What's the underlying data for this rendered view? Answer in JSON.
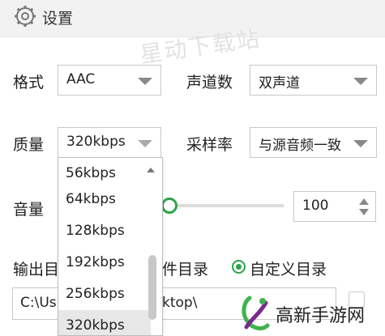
{
  "header": {
    "title": "设置",
    "icon": "gear-icon"
  },
  "watermark": "星动下载站",
  "format": {
    "label": "格式",
    "value": "AAC"
  },
  "channels": {
    "label": "声道数",
    "value": "双声道"
  },
  "quality": {
    "label": "质量",
    "value": "320kbps"
  },
  "sample_rate": {
    "label": "采样率",
    "value": "与源音频一致"
  },
  "volume": {
    "label": "音量",
    "value": "100",
    "slider_level": 0.0
  },
  "output": {
    "label": "输出目",
    "option_partial": "件目录",
    "custom_label": "自定义目录",
    "path_left": "C:\\Us",
    "path_right": "ktop\\"
  },
  "quality_dropdown": {
    "options": [
      "56kbps",
      "64kbps",
      "128kbps",
      "192kbps",
      "256kbps",
      "320kbps"
    ],
    "selected": "320kbps"
  },
  "logo": {
    "text": "高新手游网"
  },
  "colors": {
    "accent": "#2aa44a",
    "header_bg": "#f2f2f2"
  }
}
